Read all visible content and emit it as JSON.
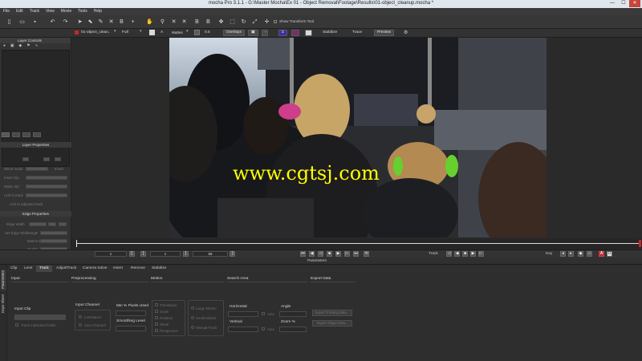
{
  "window": {
    "title": "mocha Pro 3.1.1 - G:\\Master Mocha\\Ex 01 - Object Removal\\Footage\\Results\\01-object_cleanup.mocha *",
    "minimize": "—",
    "maximize": "☐",
    "close": "✕"
  },
  "menu": [
    "File",
    "Edit",
    "Track",
    "View",
    "Movie",
    "Tools",
    "Help"
  ],
  "toolbar1": {
    "show_transform_label": "Show Transform Tool"
  },
  "toolbar2": {
    "clip": "01-object_clean..",
    "quality": "Full",
    "matte_label": "Mattes",
    "opacity": "0.5",
    "overlays": "Overlays",
    "stabilize": "Stabilize",
    "trace": "Trace",
    "preview": "Preview"
  },
  "leftpanel": {
    "layer_controls": "Layer Controls",
    "layer_properties": "Layer Properties",
    "edge_properties": "Edge Properties",
    "props": [
      "Blend mode",
      "Insert clip",
      "Matte clip",
      "Link to track"
    ],
    "edge_props": [
      "Edge Width",
      "Set Edge Width",
      "Angle",
      "Motion Blur",
      "Quality"
    ],
    "link_label": "Link to adjusted track",
    "invert_label": "Invert"
  },
  "watermark": "www.cgtsj.com",
  "transport": {
    "in_frame": "1",
    "current_frame": "1",
    "out_frame": "66",
    "track_label": "Track",
    "key_label": "Key"
  },
  "parameters": {
    "header": "Parameters",
    "tabs": [
      "Clip",
      "Lens",
      "Track",
      "AdjustTrack",
      "Camera Solve",
      "Insert",
      "Remove",
      "Stabilize"
    ],
    "active_tab": "Track",
    "side_tabs": [
      "Parameters",
      "Dope Sheet"
    ],
    "columns": {
      "input": "Input",
      "preprocessing": "Preprocessing",
      "motion": "Motion",
      "search_area": "Search Area",
      "export_data": "Export Data"
    },
    "input_clip_label": "Input Clip",
    "track_individual_fields": "Track Individual Fields",
    "input_channel": "Input Channel",
    "channel_options": [
      "Luminance",
      "Auto Channel"
    ],
    "min_pixels": "Min % Pixels Used",
    "smoothing": "Smoothing Level",
    "motion_options": [
      "Translation",
      "Scale",
      "Rotation",
      "Shear",
      "Perspective"
    ],
    "motion_type": [
      "Large Motion",
      "Small Motion",
      "Manual Track"
    ],
    "horizontal": "Horizontal",
    "vertical": "Vertical",
    "auto": "Auto",
    "angle": "Angle",
    "zoom": "Zoom %",
    "export_buttons": [
      "Export Tracking Data...",
      "Export Shape Data..."
    ]
  }
}
